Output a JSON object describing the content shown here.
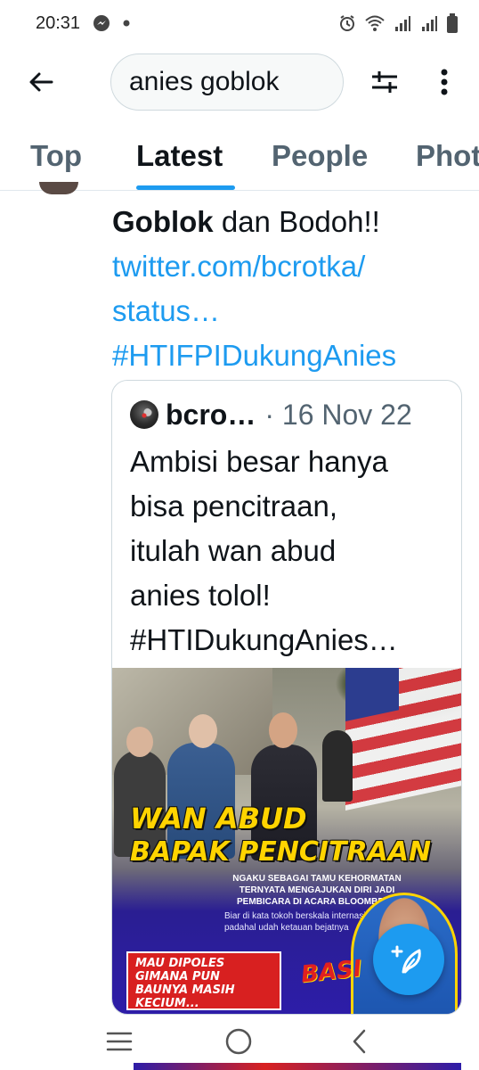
{
  "status_bar": {
    "time": "20:31",
    "left_icons": [
      "messenger-icon",
      "dot-icon"
    ],
    "right_icons": [
      "alarm-icon",
      "wifi-icon",
      "signal-icon",
      "signal-icon",
      "battery-icon"
    ]
  },
  "search": {
    "query": "anies goblok",
    "back_icon": "arrow-left-icon",
    "filter_icon": "sliders-icon",
    "more_icon": "more-vertical-icon"
  },
  "tabs": [
    {
      "label": "Top",
      "active": false
    },
    {
      "label": "Latest",
      "active": true
    },
    {
      "label": "People",
      "active": false
    },
    {
      "label": "Photos",
      "active": false
    }
  ],
  "tweet": {
    "text_bold": "Goblok",
    "text_rest": " dan Bodoh!!",
    "link_line1": "twitter.com/bcrotka/",
    "link_line2": "status…",
    "hashtag": "#HTIFPIDukungAnies"
  },
  "quote": {
    "name": "bcro…",
    "meta": "· 16 Nov 22",
    "lines": [
      "Ambisi besar hanya",
      "bisa pencitraan,",
      "itulah wan abud",
      "anies tolol!",
      "#HTIDukungAnies…"
    ],
    "image": {
      "headline1": "WAN ABUD",
      "headline2": "BAPAK PENCITRAAN",
      "sub1": "NGAKU SEBAGAI TAMU KEHORMATAN",
      "sub2": "TERNYATA MENGAJUKAN DIRI JADI",
      "sub3": "PEMBICARA DI ACARA BLOOMBERG",
      "small1": "Biar di kata tokoh berskala internasional",
      "small2": "padahal udah ketauan bejatnya",
      "box1": "MAU DIPOLES",
      "box2": "GIMANA PUN",
      "box3": "BAUNYA MASIH",
      "box4": "KECIUM...",
      "stamp": "BASI"
    }
  },
  "fab": {
    "icon": "compose-feather-icon"
  },
  "nav_bar": {
    "icons": [
      "recents-icon",
      "home-circle-icon",
      "back-chevron-icon"
    ]
  },
  "colors": {
    "accent": "#1d9bf0",
    "text": "#0f1419",
    "muted": "#536471",
    "border": "#cfd9de"
  }
}
